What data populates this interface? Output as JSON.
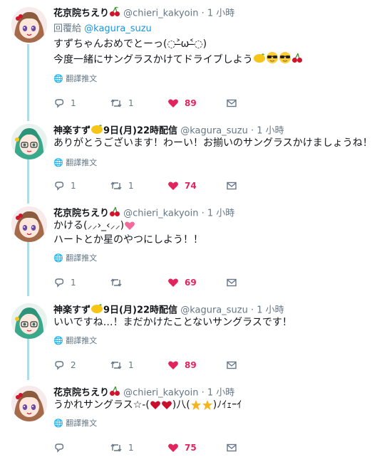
{
  "translate_label": "翻譯推文",
  "tweets": [
    {
      "name": "花京院ちえり",
      "name_emoji": "cherry",
      "handle": "@chieri_kakyoin",
      "dot": "·",
      "time": "1 小時",
      "reply_prefix": "回覆給",
      "reply_to": "@kagura_suzu",
      "lines": [
        "すずちゃんおめでとーっ(◌˃̶ω˂̶◌)",
        "今度一緒にサングラスかけてドライブしよう"
      ],
      "replies": "1",
      "retweets": "1",
      "likes": "89"
    },
    {
      "name": "神楽すず",
      "name_suffix": "9日(月)22時配信",
      "name_emoji": "lemon",
      "handle": "@kagura_suzu",
      "dot": "·",
      "time": "1 小時",
      "lines": [
        "ありがとうございます！わーい！お揃いのサングラスかけましょうね！"
      ],
      "replies": "1",
      "retweets": "1",
      "likes": "74"
    },
    {
      "name": "花京院ちえり",
      "name_emoji": "cherry",
      "handle": "@chieri_kakyoin",
      "dot": "·",
      "time": "1 小時",
      "lines": [
        "かける(⸝⸝›_‹⸝⸝)",
        "ハートとか星のやつにしよう！！"
      ],
      "replies": "1",
      "retweets": "",
      "likes": "69"
    },
    {
      "name": "神楽すず",
      "name_suffix": "9日(月)22時配信",
      "name_emoji": "lemon",
      "handle": "@kagura_suzu",
      "dot": "·",
      "time": "1 小時",
      "lines": [
        "いいですね…！まだかけたことないサングラスです！"
      ],
      "replies": "2",
      "retweets": "1",
      "likes": "89"
    },
    {
      "name": "花京院ちえり",
      "name_emoji": "cherry",
      "handle": "@chieri_kakyoin",
      "dot": "·",
      "time": "1 小時",
      "lines": [
        "うかれサングラス☆-(",
        ")八(",
        ")ﾉｲｪｰｲ"
      ],
      "replies": "",
      "retweets": "1",
      "likes": "75"
    }
  ],
  "colors": {
    "like": "#e0245e",
    "link": "#1b95e0",
    "muted": "#657786",
    "thread": "#b0dde8"
  }
}
